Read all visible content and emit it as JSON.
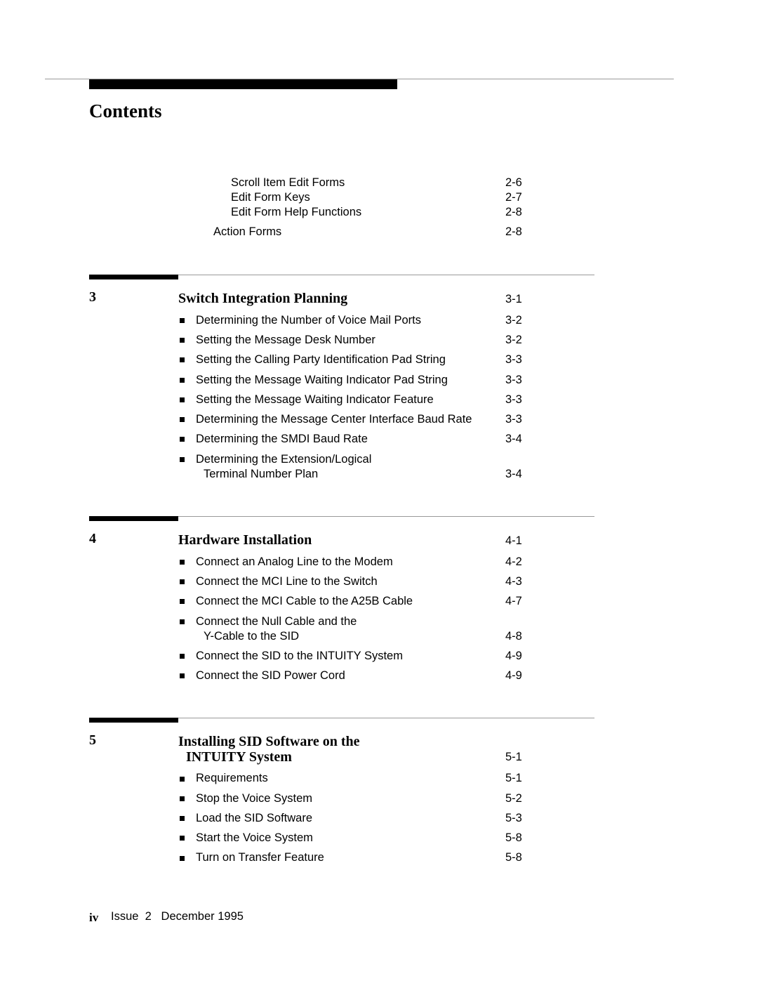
{
  "header": {
    "title": "Contents"
  },
  "continued_entries": [
    {
      "label": "Scroll Item Edit Forms",
      "page": "2-6",
      "level": 2
    },
    {
      "label": "Edit Form Keys",
      "page": "2-7",
      "level": 2
    },
    {
      "label": "Edit Form Help Functions",
      "page": "2-8",
      "level": 2
    },
    {
      "label": "Action Forms",
      "page": "2-8",
      "level": 1
    }
  ],
  "chapters": [
    {
      "number": "3",
      "title_lines": [
        "Switch Integration Planning"
      ],
      "page": "3-1",
      "entries": [
        {
          "lines": [
            "Determining the Number of Voice Mail Ports"
          ],
          "page": "3-2"
        },
        {
          "lines": [
            "Setting the Message Desk Number"
          ],
          "page": "3-2"
        },
        {
          "lines": [
            "Setting the Calling Party Identification Pad String"
          ],
          "page": "3-3"
        },
        {
          "lines": [
            "Setting the Message Waiting Indicator Pad String"
          ],
          "page": "3-3"
        },
        {
          "lines": [
            "Setting the Message Waiting Indicator Feature"
          ],
          "page": "3-3"
        },
        {
          "lines": [
            "Determining the Message Center Interface Baud Rate"
          ],
          "page": "3-3"
        },
        {
          "lines": [
            "Determining the SMDI Baud Rate"
          ],
          "page": "3-4"
        },
        {
          "lines": [
            "Determining the Extension/Logical",
            "Terminal Number Plan"
          ],
          "page": "3-4"
        }
      ]
    },
    {
      "number": "4",
      "title_lines": [
        "Hardware Installation"
      ],
      "page": "4-1",
      "entries": [
        {
          "lines": [
            "Connect an Analog Line to the Modem"
          ],
          "page": "4-2"
        },
        {
          "lines": [
            "Connect the MCI Line to the Switch"
          ],
          "page": "4-3"
        },
        {
          "lines": [
            "Connect the MCI Cable to the A25B Cable"
          ],
          "page": "4-7"
        },
        {
          "lines": [
            "Connect the Null Cable and the",
            "Y-Cable to the SID"
          ],
          "page": "4-8"
        },
        {
          "lines": [
            "Connect the SID to the INTUITY System"
          ],
          "page": "4-9"
        },
        {
          "lines": [
            "Connect the SID Power Cord"
          ],
          "page": "4-9"
        }
      ]
    },
    {
      "number": "5",
      "title_lines": [
        "Installing SID Software on the",
        "INTUITY System"
      ],
      "page": "5-1",
      "entries": [
        {
          "lines": [
            "Requirements"
          ],
          "page": "5-1"
        },
        {
          "lines": [
            "Stop the Voice System"
          ],
          "page": "5-2"
        },
        {
          "lines": [
            "Load the SID Software"
          ],
          "page": "5-3"
        },
        {
          "lines": [
            "Start the Voice System"
          ],
          "page": "5-8"
        },
        {
          "lines": [
            "Turn on Transfer Feature"
          ],
          "page": "5-8"
        }
      ]
    }
  ],
  "footer": {
    "page_number": "iv",
    "text": "Issue  2   December 1995"
  }
}
